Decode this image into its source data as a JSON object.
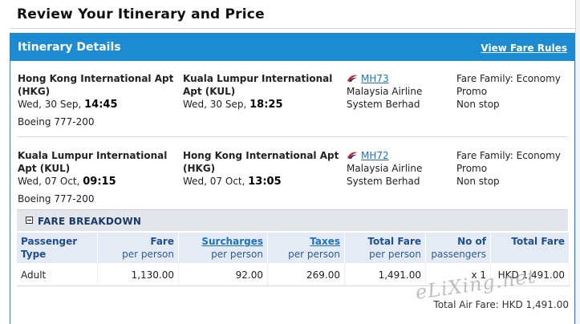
{
  "page": {
    "title": "Review Your Itinerary and Price"
  },
  "panel": {
    "title": "Itinerary Details",
    "fare_rules_link": "View Fare Rules"
  },
  "flights": [
    {
      "dep_airport": "Hong Kong International Apt (HKG)",
      "dep_date": "Wed, 30 Sep,",
      "dep_time": "14:45",
      "arr_airport": "Kuala Lumpur International Apt (KUL)",
      "arr_date": "Wed, 30 Sep,",
      "arr_time": "18:25",
      "flight_no": "MH73",
      "airline": "Malaysia Airline System Berhad",
      "fare_family": "Fare Family: Economy Promo",
      "stops": "Non stop",
      "aircraft": "Boeing 777-200"
    },
    {
      "dep_airport": "Kuala Lumpur International Apt (KUL)",
      "dep_date": "Wed, 07 Oct,",
      "dep_time": "09:15",
      "arr_airport": "Hong Kong International Apt (HKG)",
      "arr_date": "Wed, 07 Oct,",
      "arr_time": "13:05",
      "flight_no": "MH72",
      "airline": "Malaysia Airline System Berhad",
      "fare_family": "Fare Family: Economy Promo",
      "stops": "Non stop",
      "aircraft": "Boeing 777-200"
    }
  ],
  "breakdown": {
    "title": "FARE BREAKDOWN",
    "headers": {
      "passenger": "Passenger Type",
      "fare": "Fare",
      "fare_sub": "per person",
      "surcharges": "Surcharges",
      "surcharges_sub": "per person",
      "taxes": "Taxes",
      "taxes_sub": "per person",
      "total_fare": "Total Fare",
      "total_fare_sub": "per person",
      "no_of": "No of",
      "no_of_sub": "passengers",
      "total": "Total Fare"
    },
    "rows": [
      {
        "type": "Adult",
        "fare": "1,130.00",
        "surcharges": "92.00",
        "taxes": "269.00",
        "total_per_person": "1,491.00",
        "count": "x 1",
        "total": "HKD 1,491.00"
      }
    ],
    "total_air_fare": "Total Air Fare: HKD 1,491.00"
  },
  "watermark": "eLiXing.net",
  "colors": {
    "header_blue": "#1c8bd1",
    "table_header_bg": "#e5ebf4",
    "link_blue": "#1a73c8",
    "airline_logo_red": "#d2232a",
    "airline_logo_blue": "#1d3f8f"
  },
  "icons": {
    "airline_logo": "malaysia-airlines-logo-icon",
    "collapse": "minus-box-icon"
  }
}
